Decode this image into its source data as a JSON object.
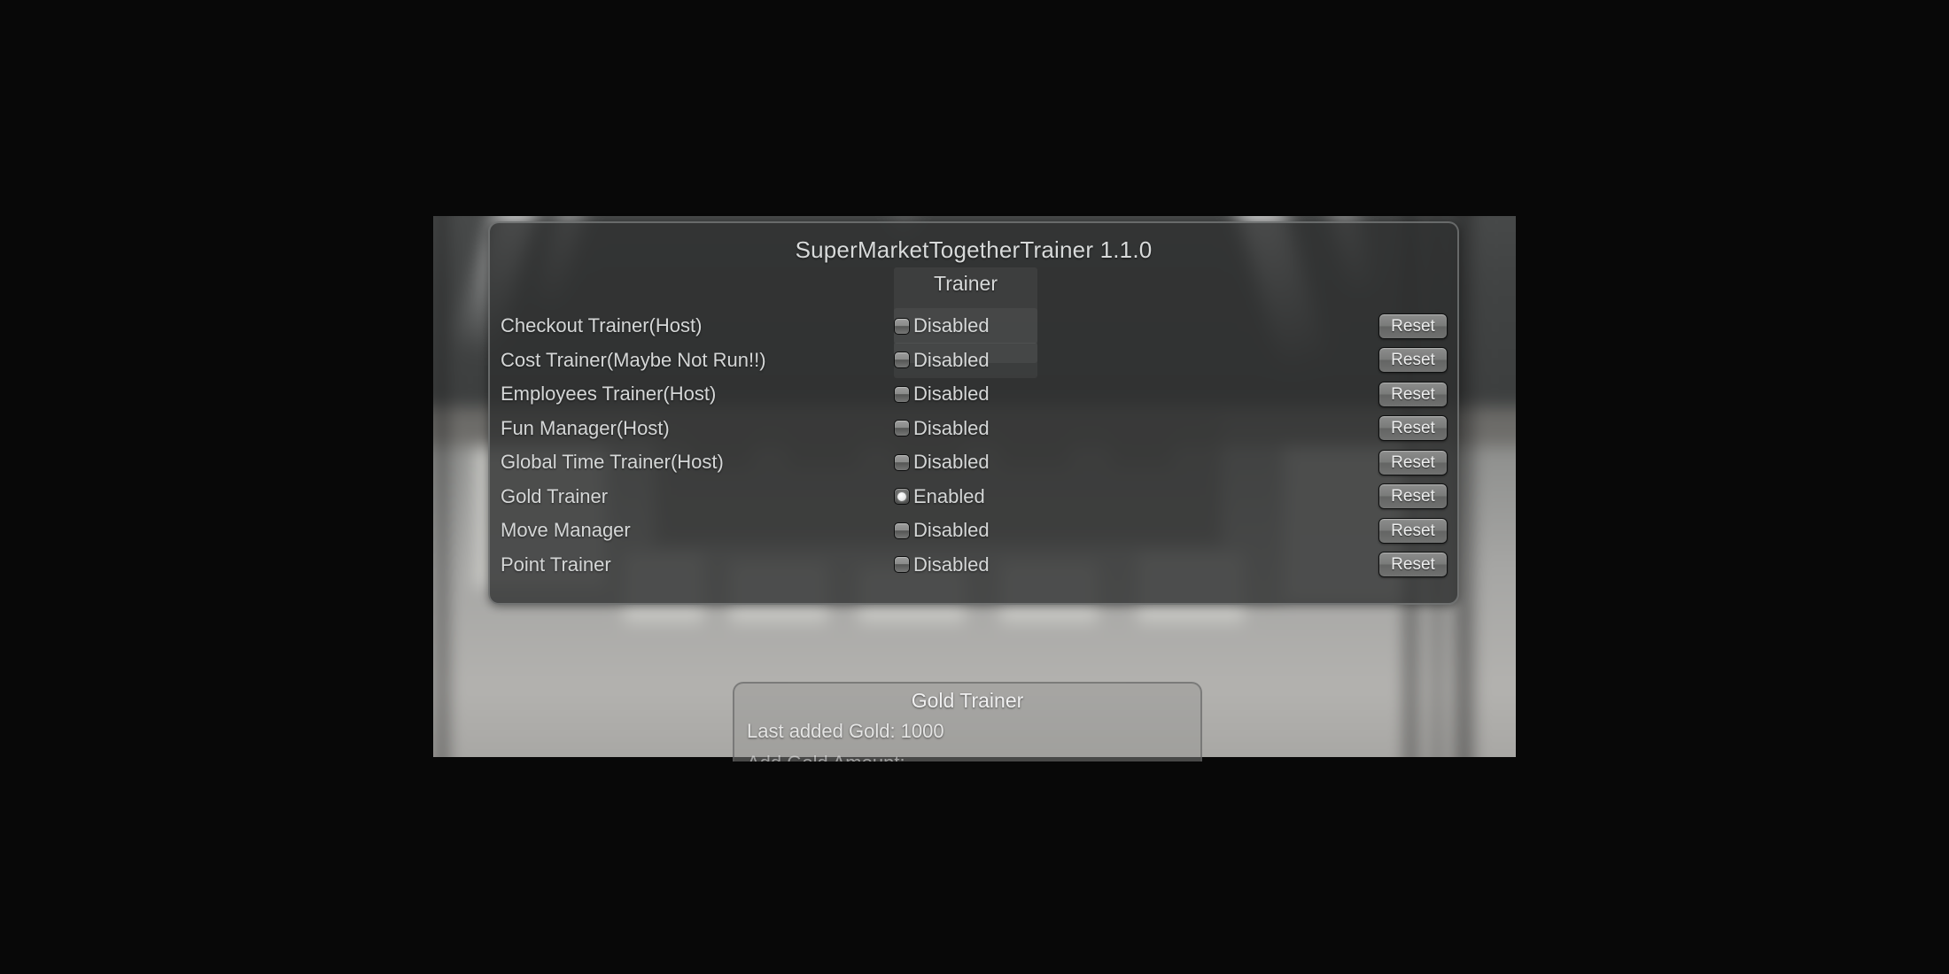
{
  "window": {
    "title": "SuperMarketTogetherTrainer 1.1.0"
  },
  "panel": {
    "column_header": "Trainer",
    "reset_label": "Reset",
    "state_enabled": "Enabled",
    "state_disabled": "Disabled",
    "rows": [
      {
        "label": "Checkout Trainer(Host)",
        "state": "Disabled",
        "enabled": false,
        "reset": "Reset"
      },
      {
        "label": "Cost Trainer(Maybe Not Run!!)",
        "state": "Disabled",
        "enabled": false,
        "reset": "Reset"
      },
      {
        "label": "Employees Trainer(Host)",
        "state": "Disabled",
        "enabled": false,
        "reset": "Reset"
      },
      {
        "label": "Fun Manager(Host)",
        "state": "Disabled",
        "enabled": false,
        "reset": "Reset"
      },
      {
        "label": "Global Time Trainer(Host)",
        "state": "Disabled",
        "enabled": false,
        "reset": "Reset"
      },
      {
        "label": "Gold Trainer",
        "state": "Enabled",
        "enabled": true,
        "reset": "Reset"
      },
      {
        "label": "Move Manager",
        "state": "Disabled",
        "enabled": false,
        "reset": "Reset"
      },
      {
        "label": "Point Trainer",
        "state": "Disabled",
        "enabled": false,
        "reset": "Reset"
      }
    ]
  },
  "gold_panel": {
    "title": "Gold Trainer",
    "last_added": "Last added Gold: 1000",
    "amount_label": "Add Gold Amount:"
  },
  "colors": {
    "panel_bg": "#2e3030",
    "panel_border": "#969898",
    "text": "#d5d7d7",
    "button_face": "#7a7b7a",
    "backdrop": "#080808"
  }
}
